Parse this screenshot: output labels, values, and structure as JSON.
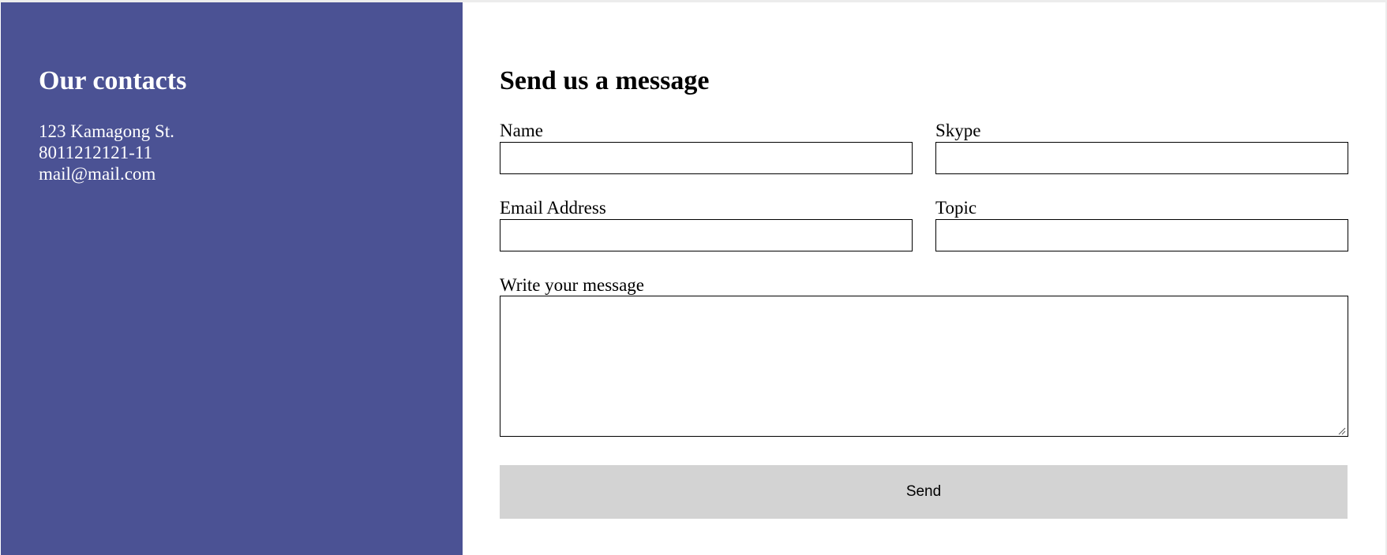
{
  "contacts": {
    "title": "Our contacts",
    "address": "123 Kamagong St.",
    "phone": "8011212121-11",
    "email": "mail@mail.com"
  },
  "form": {
    "title": "Send us a message",
    "name": {
      "label": "Name",
      "value": ""
    },
    "skype": {
      "label": "Skype",
      "value": ""
    },
    "email": {
      "label": "Email Address",
      "value": ""
    },
    "topic": {
      "label": "Topic",
      "value": ""
    },
    "message": {
      "label": "Write your message",
      "value": ""
    },
    "send_label": "Send"
  },
  "colors": {
    "sidebar_bg": "#4b5294",
    "button_bg": "#d3d3d3"
  }
}
